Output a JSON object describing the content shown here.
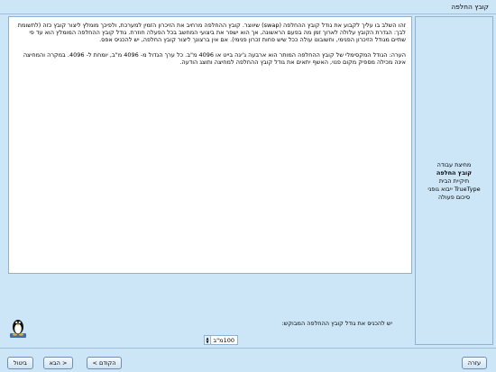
{
  "window": {
    "title": "קובץ החלפה"
  },
  "sidebar": {
    "steps": [
      {
        "label": "מחיצת עבודה",
        "active": false
      },
      {
        "label": "קובץ החלפה",
        "active": true
      },
      {
        "label": "תיקיית הבית",
        "active": false
      },
      {
        "label": "ייבוא גופני TrueType",
        "active": false
      },
      {
        "label": "סיכום פעולה",
        "active": false
      }
    ]
  },
  "content": {
    "paragraphs": [
      "זהו השלב בו עליך לקבוע את גודל קובץ ההחלפה (swap) שיווצר. קובץ ההחלפה מרחיב את הזיכרון הזמין למערכת, ולפיכך מומלץ ליצור קובץ כזה (לתשומת לבך: הגדרת הקובץ עלולה לארוך זמן מה בפעם הראשונה, אך הוא ישפר את ביצועי המחשב בכל הפעלה חוזרת. גודל קובץ ההחלפה המומלץ הוא עד פי שתיים מגודל הזיכרון הפנימי, וחשובונו עולה ככל שיש פחות זכרון פנימי). אם אין ברצונך ליצור קובץ החלפה, יש להכניס אפס.",
      "הערה: הגודל המקסימלי של קובץ ההחלפה המותר הוא ארבעה ג'יגה בייט או 4096 מ\"ב. כל ערך הגדול מ- 4096 מ\"ב, יומחת ל- 4096. במקרה והמחיצה אינה מכילה מספיק מקום פנוי, האשף יתאים את גודל קובץ ההחלפה למחיצה ותוצג הודעה."
    ],
    "question": "יש להכניס את גודל קובץ ההחלפה המבוקש:",
    "swap_size_value": "100מ\"ב"
  },
  "buttons": {
    "help": "עזרה",
    "prev": "< הקודם",
    "next": "הבא >",
    "cancel": "ביטול"
  }
}
